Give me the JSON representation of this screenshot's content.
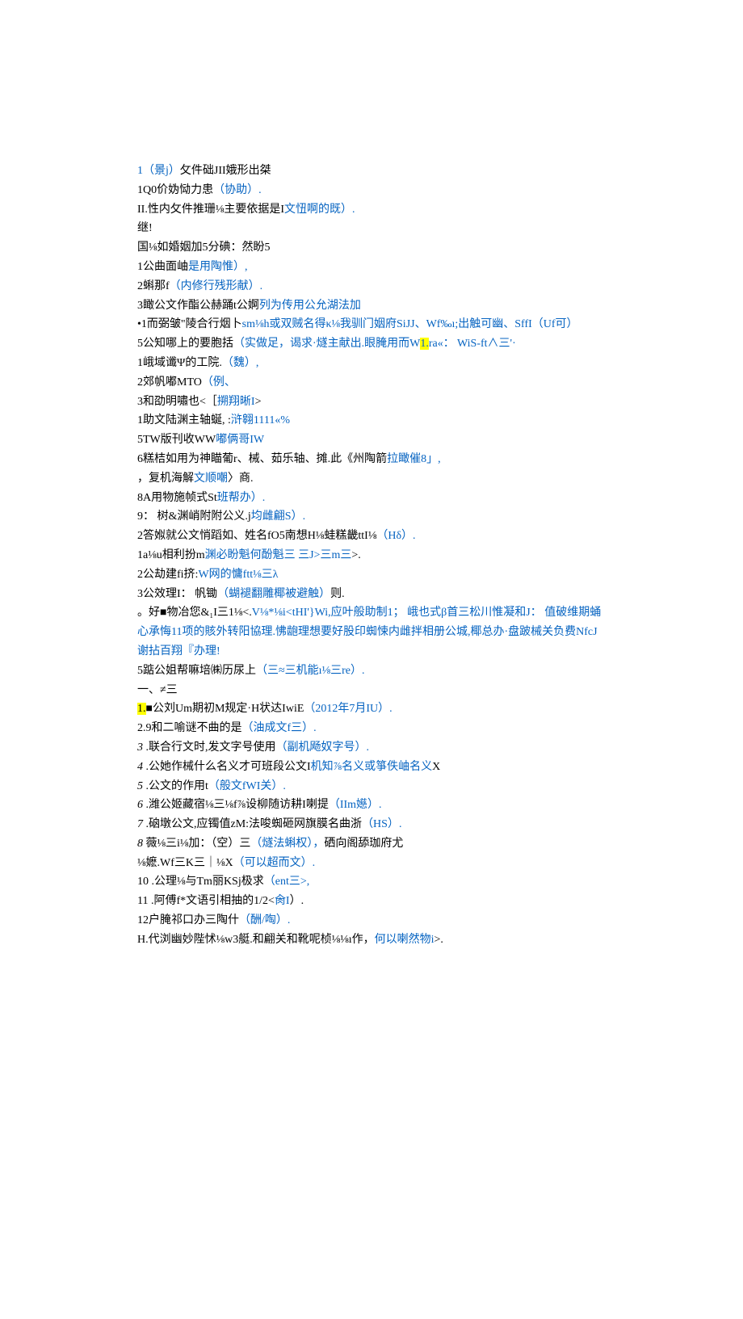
{
  "lines": [
    [
      {
        "t": "1（景j）",
        "c": "link"
      },
      {
        "t": "攵件础JII娥形出桀",
        "c": "black"
      }
    ],
    [
      {
        "t": "1Q0价妫恸力患",
        "c": "black"
      },
      {
        "t": "（协助）.",
        "c": "link"
      }
    ],
    [
      {
        "t": "II.性内攵件推珊⅛主要依据是I",
        "c": "black"
      },
      {
        "t": "文忸啊的既）.",
        "c": "link"
      }
    ],
    [
      {
        "t": "继!",
        "c": "black"
      }
    ],
    [
      {
        "t": "国⅛如婚姻加5分碘：然盼5",
        "c": "black"
      }
    ],
    [
      {
        "t": "1公曲面岫",
        "c": "black"
      },
      {
        "t": "是用陶惟）,",
        "c": "link"
      }
    ],
    [
      {
        "t": "2蝌那f",
        "c": "black"
      },
      {
        "t": "（内修行残形献）.",
        "c": "link"
      }
    ],
    [
      {
        "t": "3瞰公文作酯公赫踊t公婀",
        "c": "black"
      },
      {
        "t": "列为传用公允湖法加",
        "c": "link"
      }
    ],
    [
      {
        "t": "•1而弼皱\"陵合行烟卜",
        "c": "black"
      },
      {
        "t": "sm⅛h或双贼名得κ⅛我驯门姻府SiJJ、Wf‰ı;出触可幽、SffI（Uf可）",
        "c": "link"
      }
    ],
    [
      {
        "t": "5公知哪上的要胞括",
        "c": "black"
      },
      {
        "t": "（实做足，谒求·燧主献出.眼腌用而W",
        "c": "link"
      },
      {
        "t": "1.",
        "c": "link hl"
      },
      {
        "t": "ra«： WiS-ft∧三'·",
        "c": "link"
      }
    ],
    [
      {
        "t": "1峨域谶Ψ的工院.",
        "c": "black"
      },
      {
        "t": "（魏）,",
        "c": "link"
      }
    ],
    [
      {
        "t": "2郊帆嘟MTO",
        "c": "black"
      },
      {
        "t": "（例、",
        "c": "link"
      }
    ],
    [
      {
        "t": "3和劭明嘯也<［",
        "c": "black"
      },
      {
        "t": "搠翔晰I",
        "c": "link"
      },
      {
        "t": ">",
        "c": "black"
      }
    ],
    [
      {
        "t": "1助文陆渊主轴蜒, :",
        "c": "black"
      },
      {
        "t": "浒翱1111«%",
        "c": "link"
      }
    ],
    [
      {
        "t": "5TW版刊收WW",
        "c": "black"
      },
      {
        "t": "嘟俩哥IW",
        "c": "link"
      }
    ],
    [
      {
        "t": "6糕桔如用为神瞄葡r、械、茹乐轴、摊.此《州陶箭",
        "c": "black"
      },
      {
        "t": "拉瞰催8」,",
        "c": "link"
      }
    ],
    [
      {
        "t": "，复机海解",
        "c": "black"
      },
      {
        "t": "文顺嘲",
        "c": "link"
      },
      {
        "t": "〉商.",
        "c": "black"
      }
    ],
    [
      {
        "t": "8A用物施帧式St",
        "c": "black"
      },
      {
        "t": "班帮办）.",
        "c": "link"
      }
    ],
    [
      {
        "t": "9： 树&渊峭附附公义.j",
        "c": "black"
      },
      {
        "t": "均雌翩S）.",
        "c": "link"
      }
    ],
    [
      {
        "t": "2答娰就公文悄蹈如、姓名fO5南想H⅛蛙糕畿ttI⅛",
        "c": "black"
      },
      {
        "t": "（Hδ）.",
        "c": "link"
      }
    ],
    [
      {
        "t": "1a⅛u相利扮m",
        "c": "black"
      },
      {
        "t": "渊必盼魁何酚魁三 三J>三m三",
        "c": "link"
      },
      {
        "t": ">.",
        "c": "black"
      }
    ],
    [
      {
        "t": "2公劫建fi挤:",
        "c": "black"
      },
      {
        "t": "W网的慵ftt⅛三λ",
        "c": "link"
      }
    ],
    [
      {
        "t": "3公效理I： 帆锄",
        "c": "black"
      },
      {
        "t": "（蝴褪翻雕椰被避触）",
        "c": "link"
      },
      {
        "t": "则.",
        "c": "black"
      }
    ],
    [
      {
        "t": "。好■物冶您&₁I三1⅛<.",
        "c": "black"
      },
      {
        "t": "V⅛*⅛i<tHI'}Wi,应叶般助制1； 峨也式β首三松川惟凝和J： 值破维期蛹心承悔11项的賅外转阳協理.怫龅理想要好股印蜘悚内雌拌相册公城,椰总办·盘跛械关负费NfcJ谢拈百翔『办理!",
        "c": "link"
      }
    ],
    [
      {
        "t": "5踮公姐帮嘛培㈱历尿上",
        "c": "black"
      },
      {
        "t": "（三≈三机能ı⅛三re）.",
        "c": "link"
      }
    ],
    [
      {
        "t": "一、≠三",
        "c": "black"
      }
    ],
    [
      {
        "t": "1.",
        "c": "black hl"
      },
      {
        "t": "■公刘Um期初M规定·H状达IwiE",
        "c": "black"
      },
      {
        "t": "（2012年7月IU）.",
        "c": "link"
      }
    ],
    [
      {
        "t": "2.9和二喻谜不曲的是",
        "c": "black"
      },
      {
        "t": "（油成文f三）.",
        "c": "link"
      }
    ],
    [
      {
        "t": "3",
        "c": "black italic"
      },
      {
        "t": " .联合行文时,发文字号使用",
        "c": "black"
      },
      {
        "t": "（副机飏奴字号）.",
        "c": "link"
      }
    ],
    [
      {
        "t": "4",
        "c": "black italic"
      },
      {
        "t": " .公她作械什么名义才可班段公文I",
        "c": "black"
      },
      {
        "t": "机知⅞名义或箏佚岫名义",
        "c": "link"
      },
      {
        "t": "X",
        "c": "black"
      }
    ],
    [
      {
        "t": "5",
        "c": "black italic"
      },
      {
        "t": " .公文的作用t",
        "c": "black"
      },
      {
        "t": "（般文fWI关）.",
        "c": "link"
      }
    ],
    [
      {
        "t": "6",
        "c": "black italic"
      },
      {
        "t": " .潍公姬藏宿⅛三⅛f⅞设柳随访耕I喇提",
        "c": "black"
      },
      {
        "t": "（IIm嬨）.",
        "c": "link"
      }
    ],
    [
      {
        "t": "7",
        "c": "black italic"
      },
      {
        "t": " .硇墩公文,应镯值zM:法唆蜘砸网旗膜名曲浙",
        "c": "black"
      },
      {
        "t": "（HS）.",
        "c": "link"
      }
    ],
    [
      {
        "t": "8",
        "c": "black italic"
      },
      {
        "t": "  薇⅛三i⅛加：（空）三",
        "c": "black"
      },
      {
        "t": "（燧法蝌权），",
        "c": "link"
      },
      {
        "t": "硒向阁舔珈府尤",
        "c": "black"
      }
    ],
    [
      {
        "t": "⅛嬷.Wf三K三｜⅛X",
        "c": "black"
      },
      {
        "t": "（可以超而文）.",
        "c": "link"
      }
    ],
    [
      {
        "t": "10 .公理⅛与Tm丽KSj极求",
        "c": "black"
      },
      {
        "t": "（ent三>,",
        "c": "link"
      }
    ],
    [
      {
        "t": "11 .阿傅f*文语引相抽的1/2<",
        "c": "black"
      },
      {
        "t": "肏I",
        "c": "link"
      },
      {
        "t": "）.",
        "c": "black"
      }
    ],
    [
      {
        "t": "   12户腌祁口办三陶什",
        "c": "black"
      },
      {
        "t": "（酬/啕）.",
        "c": "link"
      }
    ],
    [
      {
        "t": "H.代浏幽妙陛怵⅛w3艇.和翩关和靴呢桢⅛⅛ı作，",
        "c": "black"
      },
      {
        "t": "何以喇然物i",
        "c": "link"
      },
      {
        "t": ">.",
        "c": "black"
      }
    ]
  ]
}
